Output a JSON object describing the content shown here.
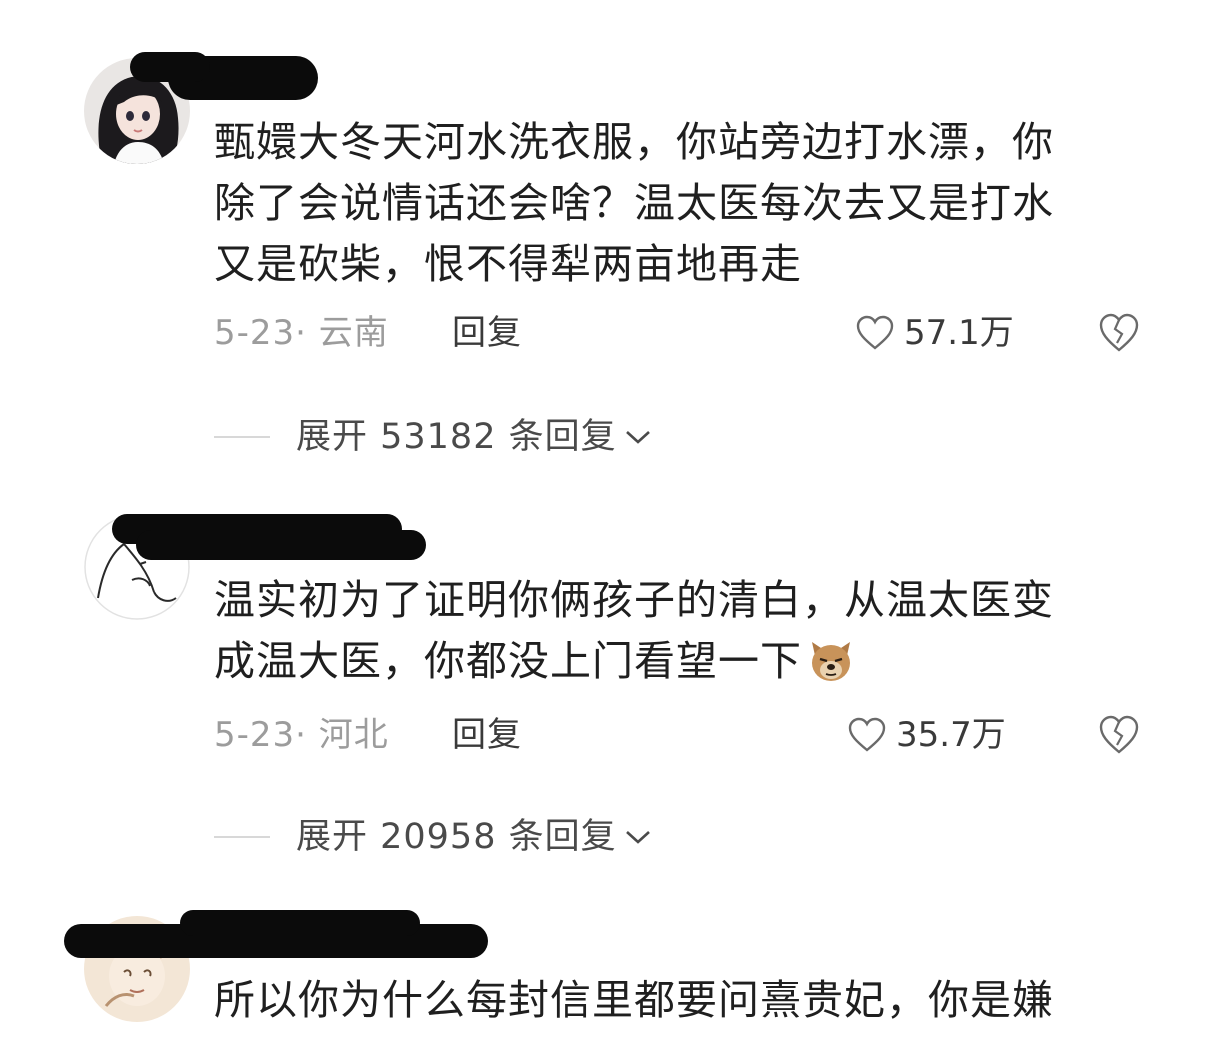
{
  "comments": [
    {
      "text_lines": [
        "甄嬛大冬天河水洗衣服，你站旁边打水漂，你",
        "除了会说情话还会啥？温太医每次去又是打水",
        "又是砍柴，恨不得犁两亩地再走"
      ],
      "date_location": "5-23· 云南",
      "reply_label": "回复",
      "like_count": "57.1万",
      "expand_label": "展开 53182 条回复"
    },
    {
      "text_lines": [
        "温实初为了证明你俩孩子的清白，从温太医变",
        "成温大医，你都没上门看望一下"
      ],
      "date_location": "5-23· 河北",
      "reply_label": "回复",
      "like_count": "35.7万",
      "expand_label": "展开 20958 条回复"
    },
    {
      "text_lines": [
        "所以你为什么每封信里都要问熹贵妃，你是嫌"
      ]
    }
  ],
  "icons": {
    "like": "heart-outline-icon",
    "dislike": "broken-heart-icon",
    "expand": "chevron-down-icon",
    "emoji": "dog-face-emoji"
  },
  "colors": {
    "meta_gray": "#9c9c9c",
    "text": "#1f1f1f",
    "redaction": "#0b0b0b"
  }
}
